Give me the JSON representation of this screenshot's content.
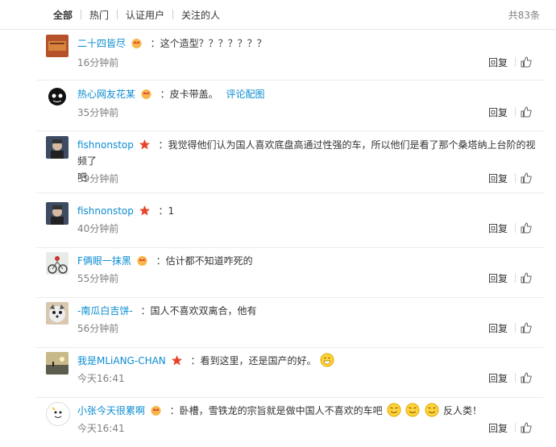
{
  "tabs": [
    {
      "label": "全部",
      "active": true
    },
    {
      "label": "热门"
    },
    {
      "label": "认证用户"
    },
    {
      "label": "关注的人"
    }
  ],
  "total": "共83条",
  "reply_label": "回复",
  "comments": [
    {
      "user": "二十四皆尽",
      "badge": "crown",
      "text": "：这个造型？？？？？？？",
      "time": "16分钟前"
    },
    {
      "user": "热心网友花某",
      "badge": "crown",
      "text": "：皮卡带盖。",
      "link": "评论配图",
      "time": "35分钟前"
    },
    {
      "user": "fishnonstop",
      "badge": "star",
      "text": "：我觉得他们认为国人喜欢底盘高通过性强的车，所以他们是看了那个桑塔纳上台阶的视频了",
      "text2": "吧",
      "time": "39分钟前"
    },
    {
      "user": "fishnonstop",
      "badge": "star",
      "text": "：1",
      "time": "40分钟前"
    },
    {
      "user": "F俩眼一抹黑",
      "badge": "crown",
      "text": "：估计都不知道咋死的",
      "time": "55分钟前"
    },
    {
      "user": "-南瓜白吉饼-",
      "badge": "",
      "text": "：国人不喜欢双离合，他有",
      "time": "56分钟前"
    },
    {
      "user": "我是MLiANG-CHAN",
      "badge": "star",
      "text": "：看到这里，还是国产的好。",
      "time": "今天16:41"
    },
    {
      "user": "小张今天很累啊",
      "badge": "crown",
      "text": "：卧槽，雪铁龙的宗旨就是做中国人不喜欢的车吧",
      "text_after": "反人类！",
      "time": "今天16:41"
    }
  ]
}
